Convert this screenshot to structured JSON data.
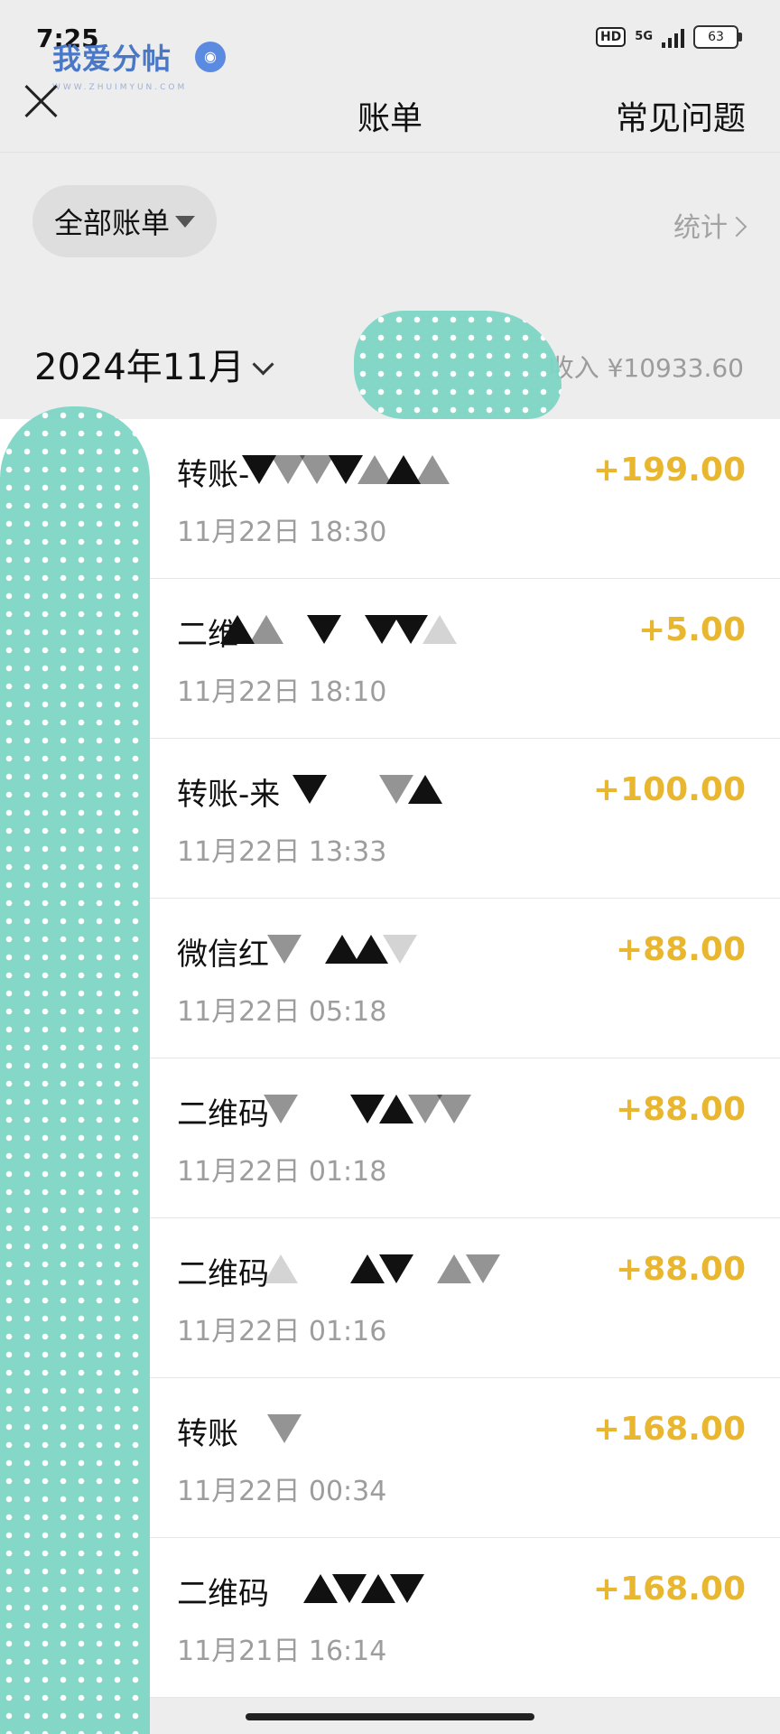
{
  "status_bar": {
    "time": "7:25",
    "network": "5G",
    "hd": "HD",
    "battery": "63",
    "signal_level": 4
  },
  "watermark": {
    "text": "我爱分帖",
    "sub": "WWW.ZHUIMYUN.COM",
    "badge_icon": "chat-bubble-icon"
  },
  "nav": {
    "title": "账单",
    "faq": "常见问题",
    "close_icon": "close-icon"
  },
  "filter": {
    "selected": "全部账单",
    "stats_label": "统计"
  },
  "month": {
    "label": "2024年11月",
    "income": "收入 ¥10933.60"
  },
  "colors": {
    "amount": "#e9b72f",
    "background": "#ededed",
    "overlay": "#7fd6c6"
  },
  "records": [
    {
      "title": "转账-",
      "time": "11月22日 18:30",
      "amount": "+199.00"
    },
    {
      "title": "二维",
      "time": "11月22日 18:10",
      "amount": "+5.00"
    },
    {
      "title": "转账-来",
      "time": "11月22日 13:33",
      "amount": "+100.00"
    },
    {
      "title": "微信红",
      "time": "11月22日 05:18",
      "amount": "+88.00"
    },
    {
      "title": "二维码",
      "time": "11月22日 01:18",
      "amount": "+88.00"
    },
    {
      "title": "二维码",
      "time": "11月22日 01:16",
      "amount": "+88.00"
    },
    {
      "title": "转账",
      "time": "11月22日 00:34",
      "amount": "+168.00"
    },
    {
      "title": "二维码",
      "time": "11月21日 16:14",
      "amount": "+168.00"
    }
  ]
}
